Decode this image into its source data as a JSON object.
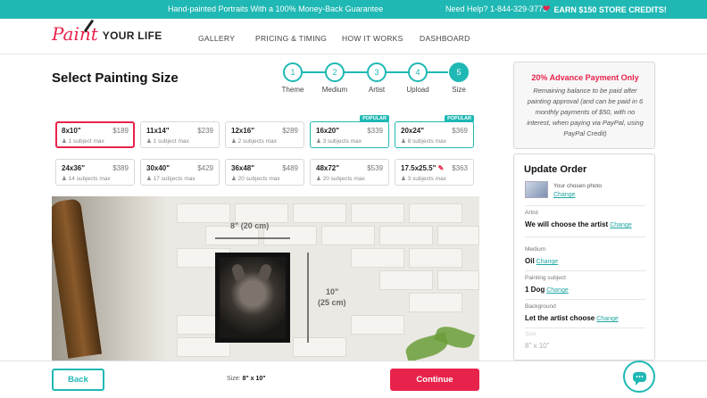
{
  "topbar": {
    "promo": "Hand-painted Portraits With a 100% Money-Back Guarantee",
    "help": "Need Help? 1-844-329-3773",
    "credits": "EARN $150 STORE CREDITS!"
  },
  "logo": {
    "paint": "Paint",
    "your_life": "YOUR LIFE"
  },
  "nav": [
    "GALLERY",
    "PRICING & TIMING",
    "HOW IT WORKS",
    "DASHBOARD"
  ],
  "page_title": "Select Painting Size",
  "steps": [
    {
      "num": "1",
      "label": "Theme"
    },
    {
      "num": "2",
      "label": "Medium"
    },
    {
      "num": "3",
      "label": "Artist"
    },
    {
      "num": "4",
      "label": "Upload"
    },
    {
      "num": "5",
      "label": "Size"
    }
  ],
  "sizes": [
    {
      "dim": "8x10\"",
      "price": "$189",
      "subjects": "1 subject max",
      "badge": ""
    },
    {
      "dim": "11x14\"",
      "price": "$239",
      "subjects": "1 subject max",
      "badge": ""
    },
    {
      "dim": "12x16\"",
      "price": "$289",
      "subjects": "2 subjects max",
      "badge": ""
    },
    {
      "dim": "16x20\"",
      "price": "$339",
      "subjects": "3 subjects max",
      "badge": "POPULAR"
    },
    {
      "dim": "20x24\"",
      "price": "$369",
      "subjects": "8 subjects max",
      "badge": "POPULAR"
    },
    {
      "dim": "24x36\"",
      "price": "$389",
      "subjects": "14 subjects max",
      "badge": ""
    },
    {
      "dim": "30x40\"",
      "price": "$429",
      "subjects": "17 subjects max",
      "badge": ""
    },
    {
      "dim": "36x48\"",
      "price": "$489",
      "subjects": "20 subjects max",
      "badge": ""
    },
    {
      "dim": "48x72\"",
      "price": "$539",
      "subjects": "20 subjects max",
      "badge": ""
    },
    {
      "dim": "17.5x25.5\"",
      "price": "$363",
      "subjects": "3 subjects max",
      "badge": ""
    }
  ],
  "preview": {
    "width_label": "8\" (20 cm)",
    "height_label_1": "10\"",
    "height_label_2": "(25 cm)"
  },
  "advance": {
    "heading": "20% Advance Payment Only",
    "body": "Remaining balance to be paid after painting approval (and can be paid in 6 monthly payments of $50, with no interest, when paying via PayPal, using PayPal Credit)"
  },
  "order": {
    "heading": "Update Order",
    "photo_label": "Your chosen photo",
    "change": "Change",
    "artist_label": "Artist",
    "artist_value": "We will choose the artist",
    "medium_label": "Medium",
    "medium_value": "Oil",
    "subject_label": "Painting subject",
    "subject_value": "1 Dog",
    "background_label": "Background",
    "background_value": "Let the artist choose",
    "size_label": "Size",
    "size_value": "8\" x 10\""
  },
  "footer": {
    "back": "Back",
    "size_label": "Size:",
    "size_value": "8\" x 10\"",
    "continue": "Continue"
  },
  "colors": {
    "teal": "#1fb8b4",
    "pink": "#e8234b"
  }
}
